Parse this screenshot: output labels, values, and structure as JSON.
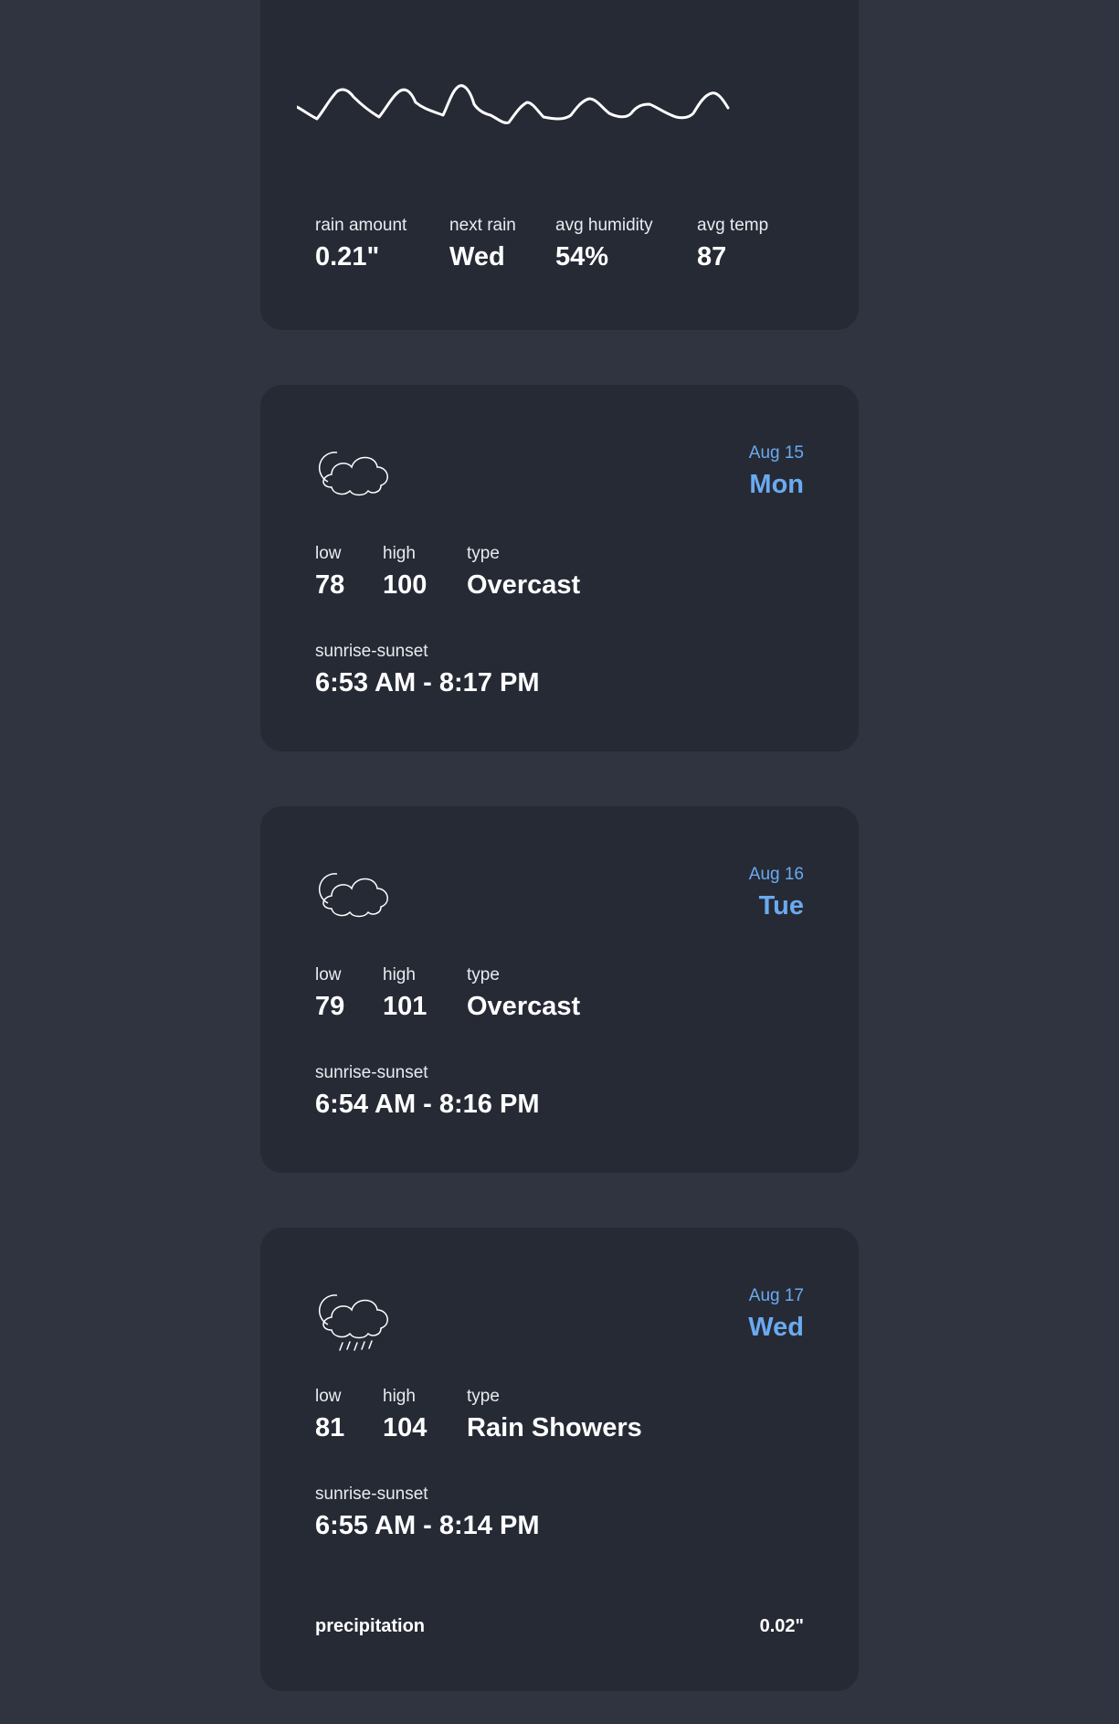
{
  "colors": {
    "page_background": "#2f3440",
    "card_background": "#262a35",
    "accent_blue": "#6aaaf0",
    "text": "#ffffff"
  },
  "summary": {
    "stats": [
      {
        "label": "rain amount",
        "value": "0.21\""
      },
      {
        "label": "next rain",
        "value": "Wed"
      },
      {
        "label": "avg humidity",
        "value": "54%"
      },
      {
        "label": "avg temp",
        "value": "87"
      }
    ]
  },
  "days": [
    {
      "date": "Aug 15",
      "day": "Mon",
      "icon": "cloudy-icon",
      "low_label": "low",
      "low": "78",
      "high_label": "high",
      "high": "100",
      "type_label": "type",
      "type": "Overcast",
      "sun_label": "sunrise-sunset",
      "sun": "6:53 AM - 8:17 PM"
    },
    {
      "date": "Aug 16",
      "day": "Tue",
      "icon": "cloudy-icon",
      "low_label": "low",
      "low": "79",
      "high_label": "high",
      "high": "101",
      "type_label": "type",
      "type": "Overcast",
      "sun_label": "sunrise-sunset",
      "sun": "6:54 AM - 8:16 PM"
    },
    {
      "date": "Aug 17",
      "day": "Wed",
      "icon": "rain-showers-icon",
      "low_label": "low",
      "low": "81",
      "high_label": "high",
      "high": "104",
      "type_label": "type",
      "type": "Rain Showers",
      "sun_label": "sunrise-sunset",
      "sun": "6:55 AM - 8:14 PM",
      "precip_label": "precipitation",
      "precip": "0.02\""
    }
  ]
}
